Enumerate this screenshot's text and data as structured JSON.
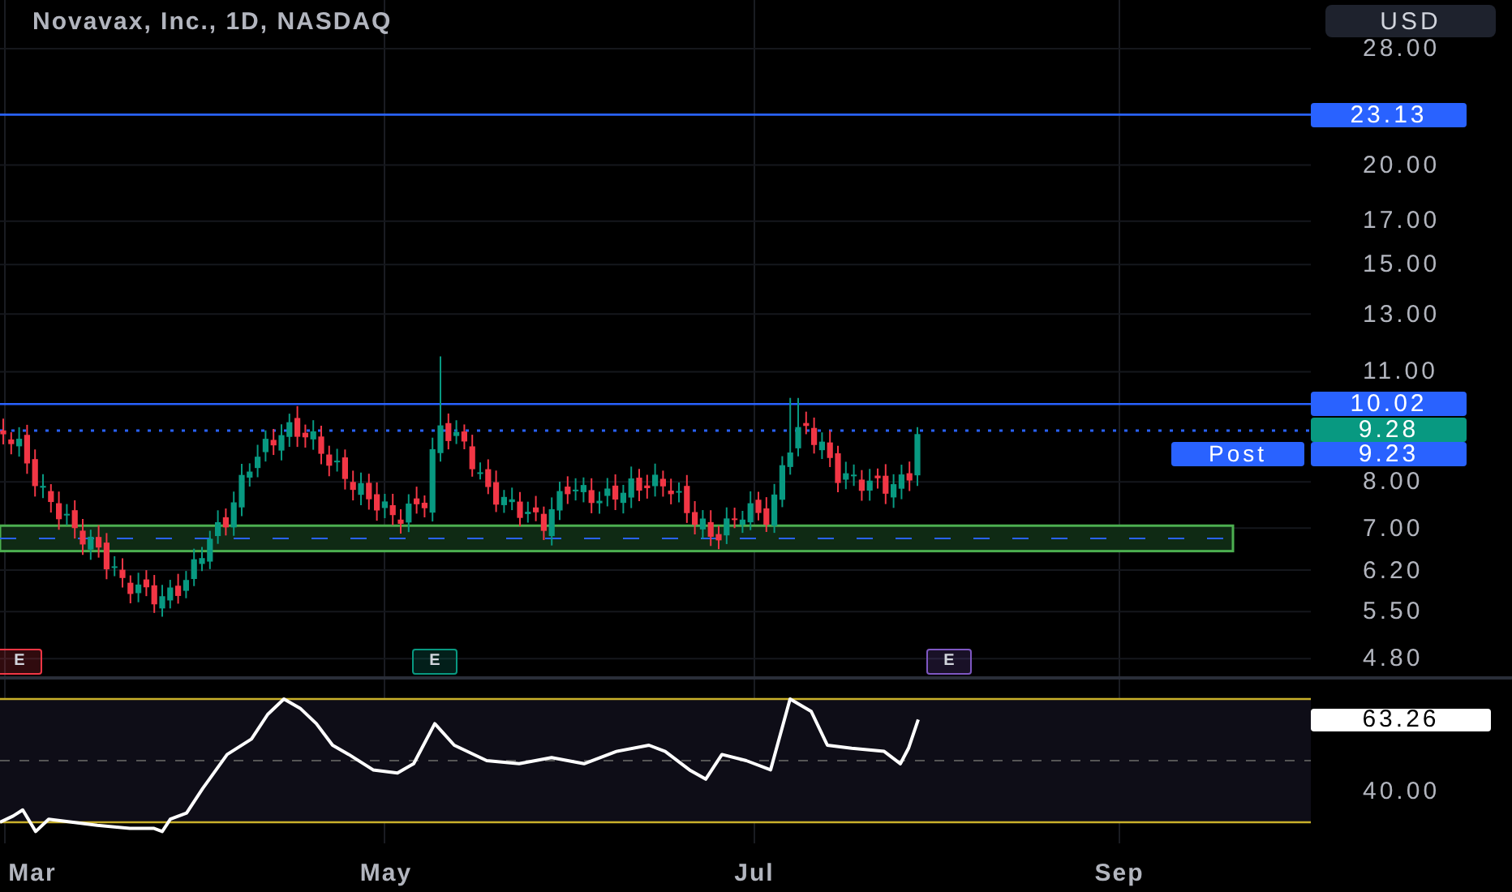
{
  "header": {
    "title": "Novavax, Inc., 1D, NASDAQ",
    "currency": "USD"
  },
  "price_axis": {
    "ticks": [
      "28.00",
      "20.00",
      "17.00",
      "15.00",
      "13.00",
      "11.00",
      "8.00",
      "7.00",
      "6.20",
      "5.50",
      "4.80"
    ]
  },
  "price_lines": [
    {
      "kind": "level",
      "label": "23.13",
      "color": "#2962ff"
    },
    {
      "kind": "level",
      "label": "10.02",
      "color": "#2962ff"
    },
    {
      "kind": "last",
      "label": "9.28",
      "color": "#089981"
    },
    {
      "kind": "post",
      "tag": "Post",
      "label": "9.23",
      "color": "#2962ff"
    }
  ],
  "earnings": [
    {
      "label": "E",
      "color": "#f23645"
    },
    {
      "label": "E",
      "color": "#089981"
    },
    {
      "label": "E",
      "color": "#7e57c2"
    }
  ],
  "rsi": {
    "ticks": [
      "40.00"
    ],
    "value": "63.26"
  },
  "time_axis": [
    "Mar",
    "May",
    "Jul",
    "Sep"
  ]
}
